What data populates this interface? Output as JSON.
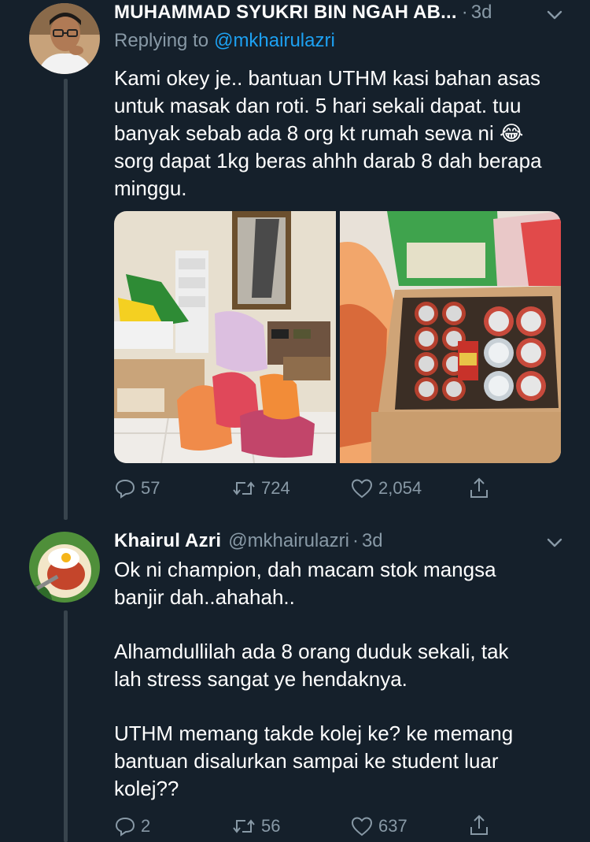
{
  "colors": {
    "background": "#15202b",
    "muted": "#8899a6",
    "link": "#1da1f2",
    "thread_line": "#38444d"
  },
  "tweets": [
    {
      "author_name": "MUHAMMAD SYUKRI BIN NGAH AB...",
      "handle": "",
      "separator": "·",
      "time": "3d",
      "replying_prefix": "Replying to",
      "replying_to": "@mkhairulazri",
      "body": "Kami okey je.. bantuan UTHM kasi bahan asas untuk masak dan roti. 5 hari sekali dapat. tuu banyak sebab ada 8 org kt rumah sewa ni 😂 sorg dapat 1kg beras ahhh darab 8 dah berapa minggu.",
      "avatar_icon": "person-with-glasses-avatar",
      "media_icons": [
        "groceries-room-photo",
        "canned-food-box-photo"
      ],
      "replies": "57",
      "retweets": "724",
      "likes": "2,054"
    },
    {
      "author_name": "Khairul Azri",
      "handle": "@mkhairulazri",
      "separator": "·",
      "time": "3d",
      "body_paragraphs": [
        "Ok ni champion, dah macam stok mangsa\nbanjir dah..ahahah..",
        "Alhamdullilah ada 8 orang duduk sekali, tak\nlah stress sangat ye hendaknya.",
        "UTHM memang takde kolej ke? ke memang\nbantuan disalurkan sampai ke student luar\nkolej??"
      ],
      "avatar_icon": "fried-egg-rice-avatar",
      "replies": "2",
      "retweets": "56",
      "likes": "637"
    }
  ]
}
